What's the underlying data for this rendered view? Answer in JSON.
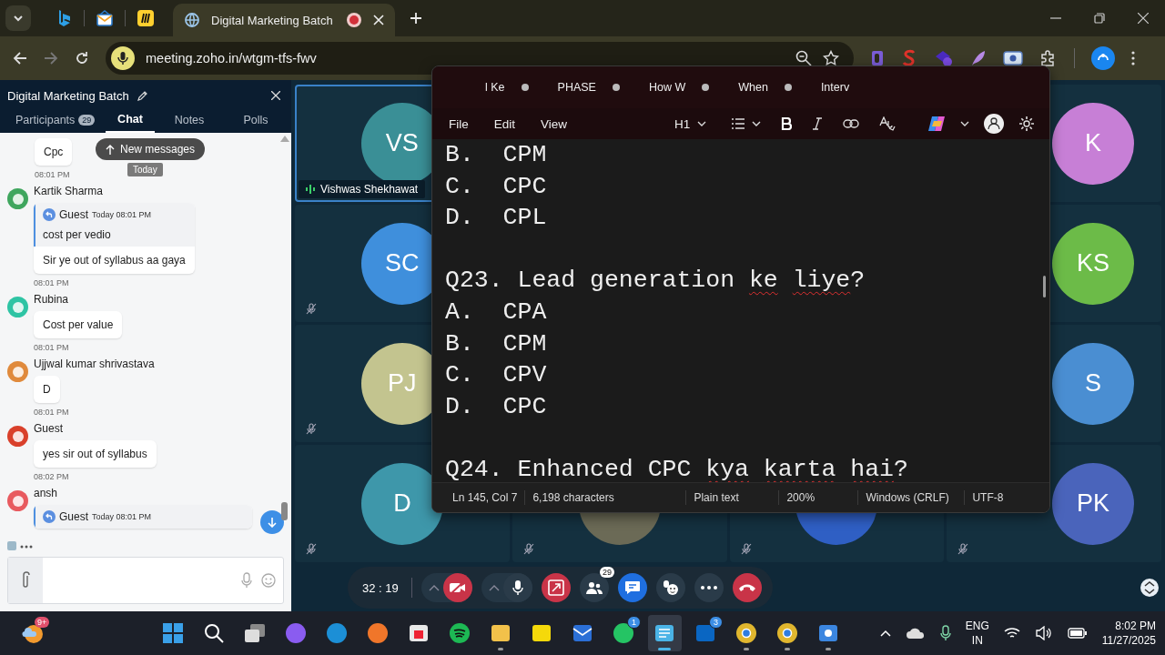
{
  "browser": {
    "tabs": [
      {
        "kind": "bing",
        "selected": false
      },
      {
        "kind": "mail",
        "selected": false
      },
      {
        "kind": "miro",
        "selected": false
      },
      {
        "kind": "page",
        "title": "Digital Marketing Batch",
        "recording": true,
        "selected": true
      }
    ],
    "url": "meeting.zoho.in/wtgm-tfs-fwv"
  },
  "chat": {
    "title": "Digital Marketing Batch",
    "tabs": [
      {
        "label": "Participants",
        "badge": "29",
        "selected": false
      },
      {
        "label": "Chat",
        "selected": true
      },
      {
        "label": "Notes",
        "selected": false
      },
      {
        "label": "Polls",
        "selected": false
      }
    ],
    "new_messages": "New messages",
    "day_label": "Today",
    "messages": [
      {
        "text": "Cpc",
        "time": "08:01 PM"
      },
      {
        "author": "Kartik Sharma",
        "color": "#3fa65e",
        "quote": {
          "author": "Guest",
          "time": "Today 08:01 PM",
          "text": "cost per vedio"
        },
        "text": "Sir ye out of syllabus aa gaya",
        "time": "08:01 PM"
      },
      {
        "author": "Rubina",
        "color": "#2ec4a4",
        "text": "Cost per value",
        "time": "08:01 PM"
      },
      {
        "author": "Ujjwal kumar shrivastava",
        "color": "#e08a3c",
        "text": "D",
        "time": "08:01 PM"
      },
      {
        "author": "Guest",
        "color": "#d9402b",
        "text": "yes sir out of syllabus",
        "time": "08:02 PM"
      },
      {
        "author": "ansh",
        "color": "#e85a5f",
        "quote": {
          "author": "Guest",
          "time": "Today 08:01 PM"
        }
      }
    ]
  },
  "tile_columns": [
    [
      {
        "initials": "VS",
        "color": "#3a8f96",
        "name": "Vishwas Shekhawat",
        "speaking": true,
        "muted": false
      },
      {
        "initials": "SC",
        "color": "#3f8fdc",
        "speaking": false,
        "muted": true
      },
      {
        "initials": "PJ",
        "color": "#c3c48f",
        "speaking": false,
        "muted": true
      },
      {
        "initials": "D",
        "color": "#3e97aa",
        "speaking": false,
        "muted": true
      }
    ],
    [
      {
        "color": "#6b6a56",
        "speaking": false,
        "muted": true
      }
    ],
    [
      {
        "color": "#2f5fc4",
        "speaking": false,
        "muted": true
      }
    ],
    [
      {
        "initials": "K",
        "color": "#c77fd6",
        "speaking": false,
        "muted": false
      },
      {
        "initials": "KS",
        "color": "#6cbb48",
        "speaking": false,
        "muted": false
      },
      {
        "initials": "S",
        "color": "#4a8ed2",
        "speaking": false,
        "muted": false
      },
      {
        "initials": "PK",
        "color": "#4a64bb",
        "speaking": false,
        "muted": true
      }
    ]
  ],
  "call": {
    "timer": "32 : 19",
    "camera_on": false,
    "mic_on": true,
    "participants_badge": "29"
  },
  "notepad": {
    "tabs": [
      {
        "title": "l Ke",
        "unsaved": true,
        "selected": false
      },
      {
        "title": "PHASE",
        "unsaved": true,
        "selected": false
      },
      {
        "title": "How W",
        "unsaved": true,
        "selected": false
      },
      {
        "title": "When",
        "unsaved": true,
        "selected": false
      },
      {
        "title": "Interv",
        "unsaved": false,
        "selected": false
      }
    ],
    "menu": [
      "File",
      "Edit",
      "View"
    ],
    "heading": "H1",
    "lines": [
      {
        "segments": [
          {
            "text": "B.  CPM",
            "misspelled": false
          }
        ]
      },
      {
        "segments": [
          {
            "text": "C.  CPC",
            "misspelled": false
          }
        ]
      },
      {
        "segments": [
          {
            "text": "D.  CPL",
            "misspelled": false
          }
        ]
      },
      {
        "gap_before": true,
        "segments": [
          {
            "text": "Q23. Lead generation",
            "misspelled": false
          },
          {
            "text": "ke",
            "misspelled": true,
            "space_before": true
          },
          {
            "text": "liye",
            "misspelled": true,
            "space_before": true
          },
          {
            "text": "?",
            "misspelled": false
          }
        ]
      },
      {
        "segments": [
          {
            "text": "A.  CPA",
            "misspelled": false
          }
        ]
      },
      {
        "segments": [
          {
            "text": "B.  CPM",
            "misspelled": false
          }
        ]
      },
      {
        "segments": [
          {
            "text": "C.  CPV",
            "misspelled": false
          }
        ]
      },
      {
        "segments": [
          {
            "text": "D.  CPC",
            "misspelled": false
          }
        ]
      },
      {
        "gap_before": true,
        "segments": [
          {
            "text": "Q24. Enhanced CPC",
            "misspelled": false
          },
          {
            "text": "kya",
            "misspelled": true,
            "space_before": true
          },
          {
            "text": "karta",
            "misspelled": true,
            "space_before": true
          },
          {
            "text": "hai",
            "misspelled": true,
            "space_before": true
          },
          {
            "text": "?",
            "misspelled": false
          }
        ]
      }
    ],
    "status": [
      "Ln 145, Col 7",
      "6,198 characters",
      "Plain text",
      "200%",
      "Windows (CRLF)",
      "UTF-8"
    ]
  },
  "taskbar": {
    "weather_badge": "9+",
    "apps": [
      {
        "kind": "start",
        "running": false,
        "active": false
      },
      {
        "kind": "search",
        "running": false,
        "active": false
      },
      {
        "kind": "taskview",
        "running": false,
        "active": false
      },
      {
        "kind": "copilot",
        "running": false,
        "active": false
      },
      {
        "kind": "edge",
        "running": false,
        "active": false
      },
      {
        "kind": "firefox",
        "running": false,
        "active": false
      },
      {
        "kind": "store",
        "running": false,
        "active": false
      },
      {
        "kind": "spotify",
        "running": false,
        "active": false
      },
      {
        "kind": "folder",
        "running": true,
        "active": false
      },
      {
        "kind": "sticky",
        "running": false,
        "active": false
      },
      {
        "kind": "mail",
        "running": false,
        "active": false
      },
      {
        "kind": "whatsapp",
        "badge": "1",
        "running": false,
        "active": false
      },
      {
        "kind": "notepad",
        "running": true,
        "active": true
      },
      {
        "kind": "linkedin",
        "badge": "3",
        "running": false,
        "active": false
      },
      {
        "kind": "chrome",
        "running": true,
        "active": false
      },
      {
        "kind": "chrome",
        "running": true,
        "active": false
      },
      {
        "kind": "camera",
        "running": true,
        "active": false
      }
    ],
    "language": "ENG",
    "region": "IN",
    "time": "8:02 PM",
    "date": "11/27/2025"
  }
}
